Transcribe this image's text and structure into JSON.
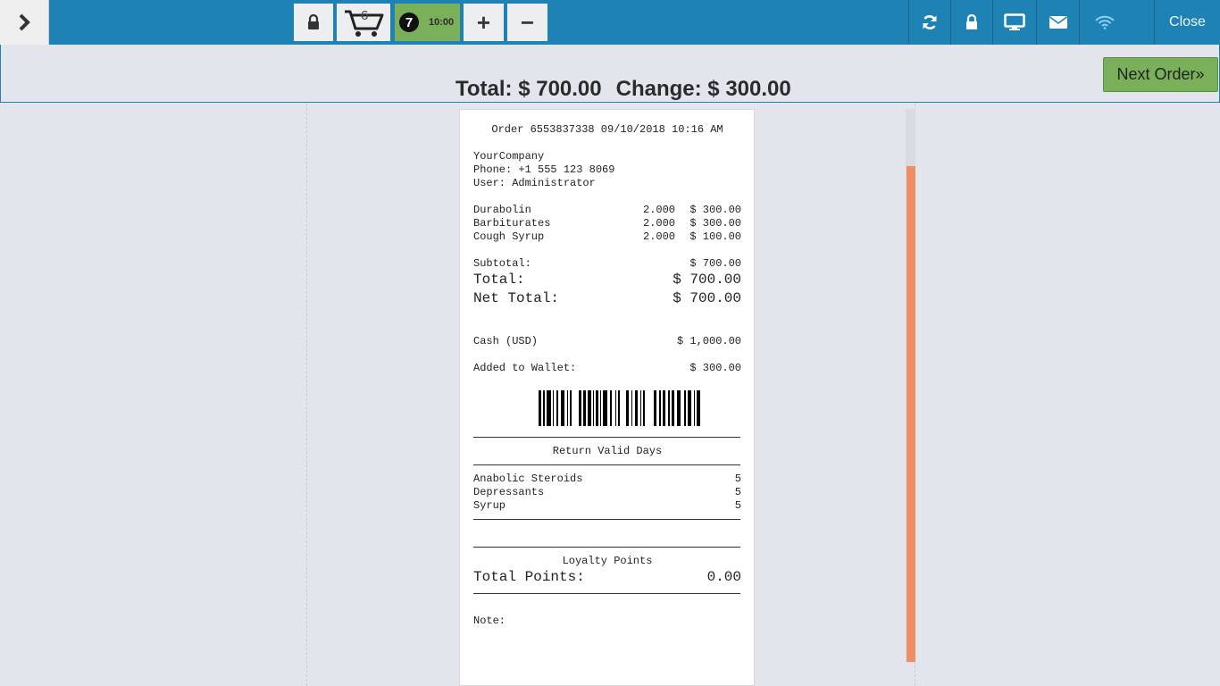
{
  "topbar": {
    "cart_count": "6",
    "order_number": "7",
    "order_time": "10:00",
    "plus_label": "+",
    "minus_label": "−",
    "close_label": "Close"
  },
  "summary": {
    "total": "Total: $ 700.00",
    "change": "Change: $ 300.00",
    "next_order_label": "Next Order»"
  },
  "receipt": {
    "header": "Order 6553837338 09/10/2018 10:16 AM",
    "company": "YourCompany",
    "phone": "Phone: +1 555 123 8069",
    "user": "User: Administrator",
    "lines": [
      {
        "product": "Durabolin",
        "qty": "2.000",
        "price": "$ 300.00"
      },
      {
        "product": "Barbiturates",
        "qty": "2.000",
        "price": "$ 300.00"
      },
      {
        "product": "Cough Syrup",
        "qty": "2.000",
        "price": "$ 100.00"
      }
    ],
    "subtotal_label": "Subtotal:",
    "subtotal_value": "$ 700.00",
    "total_label": "Total:",
    "total_value": "$ 700.00",
    "net_total_label": "Net Total:",
    "net_total_value": "$ 700.00",
    "payment_label": "Cash (USD)",
    "payment_value": "$ 1,000.00",
    "wallet_label": "Added to Wallet:",
    "wallet_value": "$ 300.00",
    "return_title": "Return Valid Days",
    "return_items": [
      {
        "category": "Anabolic Steroids",
        "days": "5"
      },
      {
        "category": "Depressants",
        "days": "5"
      },
      {
        "category": "Syrup",
        "days": "5"
      }
    ],
    "loyalty_title": "Loyalty Points",
    "points_label": "Total Points:",
    "points_value": "0.00",
    "note_label": "Note:"
  },
  "icons": {
    "menu": "chevron-right-icon",
    "lock": "lock-icon",
    "cart": "cart-icon",
    "refresh": "refresh-icon",
    "monitor": "monitor-icon",
    "mail": "mail-icon",
    "wifi": "wifi-icon"
  },
  "colors": {
    "topbar": "#1f82b4",
    "accent_green": "#7bb05a",
    "scroll_thumb": "#ef8d66"
  }
}
